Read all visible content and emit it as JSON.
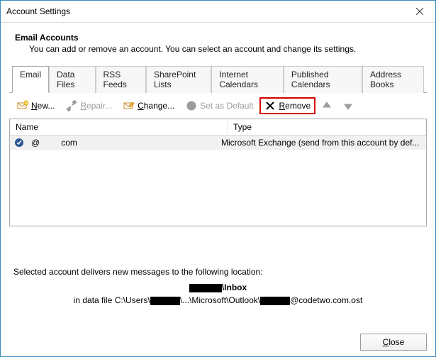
{
  "window": {
    "title": "Account Settings"
  },
  "header": {
    "heading": "Email Accounts",
    "subheading": "You can add or remove an account. You can select an account and change its settings."
  },
  "tabs": [
    "Email",
    "Data Files",
    "RSS Feeds",
    "SharePoint Lists",
    "Internet Calendars",
    "Published Calendars",
    "Address Books"
  ],
  "toolbar": {
    "new": "New...",
    "repair": "Repair...",
    "change": "Change...",
    "set_default": "Set as Default",
    "remove": "Remove"
  },
  "table": {
    "columns": [
      "Name",
      "Type"
    ],
    "rows": [
      {
        "name_at": "@",
        "name_domain": "com",
        "type": "Microsoft Exchange (send from this account by def..."
      }
    ]
  },
  "location": {
    "heading": "Selected account delivers new messages to the following location:",
    "folder": "\\Inbox",
    "prefix": "in data file C:\\Users\\",
    "mid": "\\...\\Microsoft\\Outlook\\",
    "suffix": "@codetwo.com.ost"
  },
  "footer": {
    "close": "Close"
  }
}
